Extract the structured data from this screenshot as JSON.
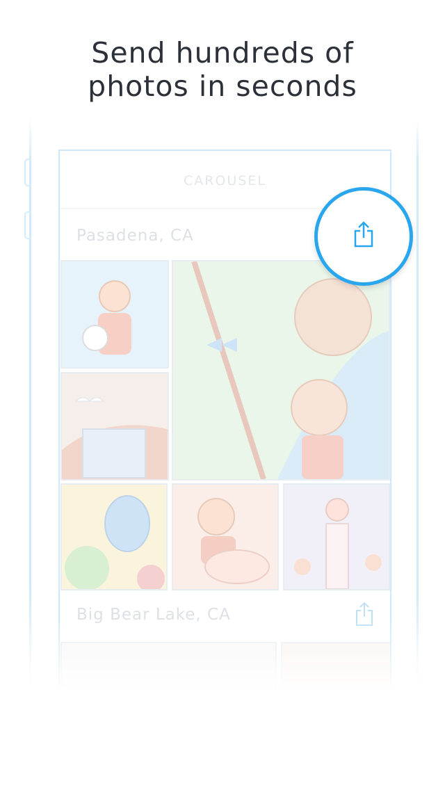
{
  "headline": {
    "line1": "Send hundreds of",
    "line2": "photos in seconds"
  },
  "app": {
    "title": "CAROUSEL"
  },
  "sections": [
    {
      "location": "Pasadena, CA",
      "icon": "share-icon"
    },
    {
      "location": "Big Bear Lake, CA",
      "icon": "share-icon"
    }
  ],
  "colors": {
    "accent": "#2aa6ee",
    "outline": "#cfe9fb",
    "headline": "#2c3038"
  }
}
